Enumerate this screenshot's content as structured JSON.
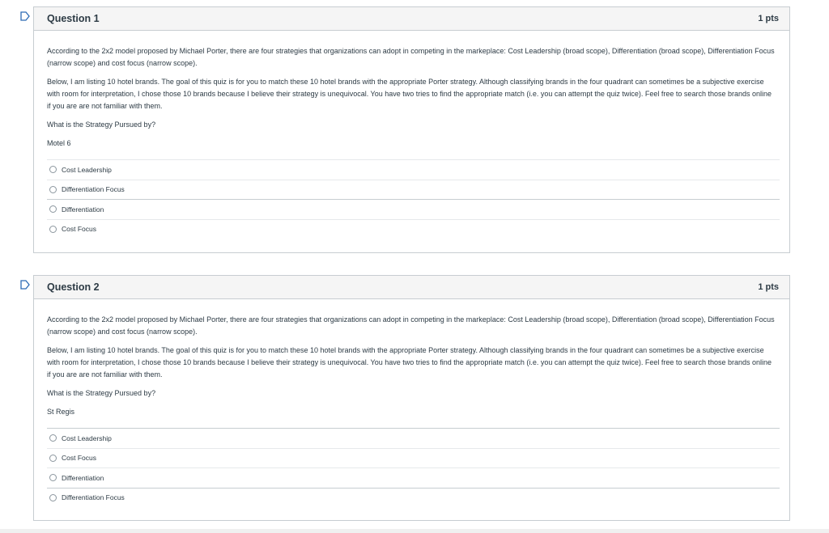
{
  "questions": [
    {
      "title": "Question 1",
      "points": "1 pts",
      "paragraph1": "According to the 2x2 model proposed by Michael Porter, there are four strategies that organizations can adopt in competing in the markeplace: Cost Leadership (broad scope), Differentiation (broad scope), Differentiation Focus (narrow scope) and cost focus (narrow scope).",
      "paragraph2": "Below, I am listing 10 hotel brands. The goal of this quiz is for you to  match these 10 hotel brands with the appropriate Porter strategy. Although classifying brands in the four quadrant can sometimes be a subjective exercise with room for interpretation, I chose those 10 brands because I believe their strategy is unequivocal. You have two tries to find the appropriate match (i.e. you can attempt the quiz twice). Feel free to search those brands online if you are are not familiar with them.",
      "prompt": "What is the Strategy Pursued by?",
      "subject": "Motel 6",
      "answers": [
        "Cost Leadership",
        "Differentiation Focus",
        "Differentiation",
        "Cost Focus"
      ]
    },
    {
      "title": "Question 2",
      "points": "1 pts",
      "paragraph1": "According to the 2x2 model proposed by Michael Porter, there are four strategies that organizations can adopt in competing in the markeplace: Cost Leadership (broad scope), Differentiation (broad scope), Differentiation Focus (narrow scope) and cost focus (narrow scope).",
      "paragraph2": "Below, I am listing 10 hotel brands. The goal of this quiz is for you to  match these 10 hotel brands with the appropriate Porter strategy. Although classifying brands in the four quadrant can sometimes be a subjective exercise with room for interpretation, I chose those 10 brands because I believe their strategy is unequivocal. You have two tries to find the appropriate match (i.e. you can attempt the quiz twice). Feel free to search those brands online if you are are not familiar with them.",
      "prompt": "What is the Strategy Pursued by?",
      "subject": "St Regis",
      "answers": [
        "Cost Leadership",
        "Cost Focus",
        "Differentiation",
        "Differentiation Focus"
      ]
    }
  ],
  "colors": {
    "flag": "#2d6bb5",
    "header_bg": "#f5f5f5",
    "border": "#c7cdd1"
  },
  "icons": {
    "flag": "flag-icon",
    "radio": "radio-icon"
  }
}
